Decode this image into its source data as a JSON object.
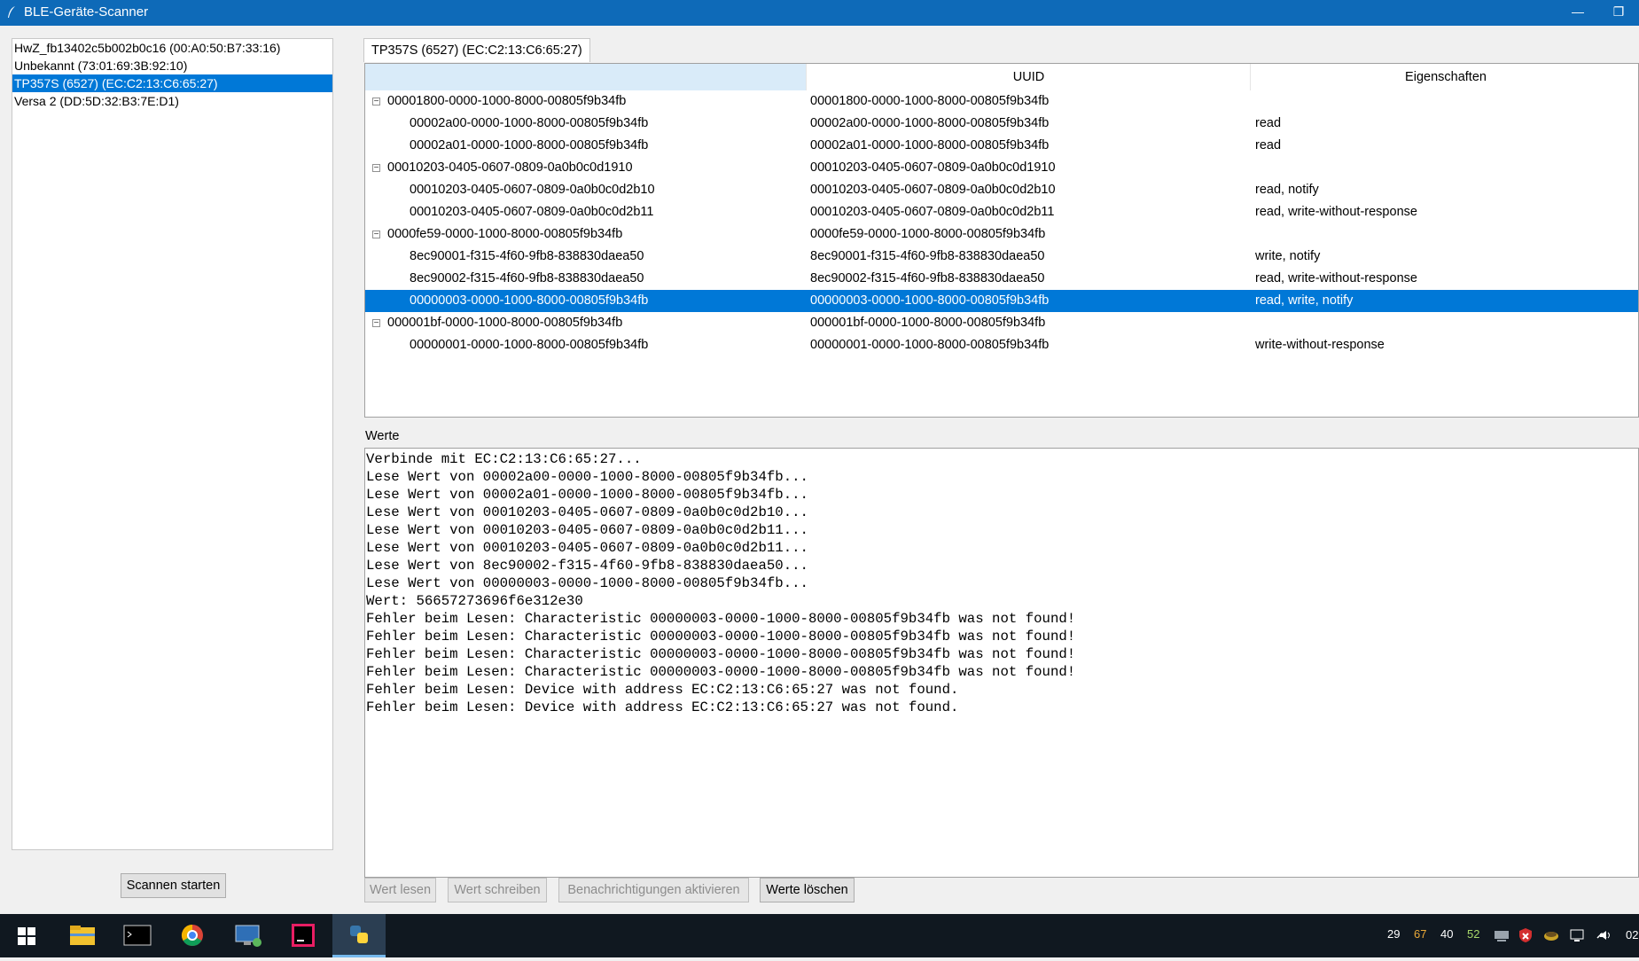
{
  "window": {
    "title": "BLE-Geräte-Scanner",
    "minimize_glyph": "—",
    "restore_glyph": "❐"
  },
  "devices": [
    {
      "label": "HwZ_fb13402c5b002b0c16 (00:A0:50:B7:33:16)",
      "selected": false
    },
    {
      "label": "Unbekannt (73:01:69:3B:92:10)",
      "selected": false
    },
    {
      "label": "TP357S (6527) (EC:C2:13:C6:65:27)",
      "selected": true
    },
    {
      "label": "Versa 2 (DD:5D:32:B3:7E:D1)",
      "selected": false
    }
  ],
  "scan_button": "Scannen starten",
  "tab": {
    "label": "TP357S (6527) (EC:C2:13:C6:65:27)"
  },
  "tree": {
    "columns": [
      "",
      "UUID",
      "Eigenschaften"
    ],
    "expander_glyph": "−",
    "rows": [
      {
        "name": "00001800-0000-1000-8000-00805f9b34fb",
        "uuid": "00001800-0000-1000-8000-00805f9b34fb",
        "props": "",
        "level": 0
      },
      {
        "name": "00002a00-0000-1000-8000-00805f9b34fb",
        "uuid": "00002a00-0000-1000-8000-00805f9b34fb",
        "props": "read",
        "level": 1
      },
      {
        "name": "00002a01-0000-1000-8000-00805f9b34fb",
        "uuid": "00002a01-0000-1000-8000-00805f9b34fb",
        "props": "read",
        "level": 1
      },
      {
        "name": "00010203-0405-0607-0809-0a0b0c0d1910",
        "uuid": "00010203-0405-0607-0809-0a0b0c0d1910",
        "props": "",
        "level": 0
      },
      {
        "name": "00010203-0405-0607-0809-0a0b0c0d2b10",
        "uuid": "00010203-0405-0607-0809-0a0b0c0d2b10",
        "props": "read, notify",
        "level": 1
      },
      {
        "name": "00010203-0405-0607-0809-0a0b0c0d2b11",
        "uuid": "00010203-0405-0607-0809-0a0b0c0d2b11",
        "props": "read, write-without-response",
        "level": 1
      },
      {
        "name": "0000fe59-0000-1000-8000-00805f9b34fb",
        "uuid": "0000fe59-0000-1000-8000-00805f9b34fb",
        "props": "",
        "level": 0
      },
      {
        "name": "8ec90001-f315-4f60-9fb8-838830daea50",
        "uuid": "8ec90001-f315-4f60-9fb8-838830daea50",
        "props": "write, notify",
        "level": 1
      },
      {
        "name": "8ec90002-f315-4f60-9fb8-838830daea50",
        "uuid": "8ec90002-f315-4f60-9fb8-838830daea50",
        "props": "read, write-without-response",
        "level": 1
      },
      {
        "name": "00000003-0000-1000-8000-00805f9b34fb",
        "uuid": "00000003-0000-1000-8000-00805f9b34fb",
        "props": "read, write, notify",
        "level": 1,
        "selected": true
      },
      {
        "name": "000001bf-0000-1000-8000-00805f9b34fb",
        "uuid": "000001bf-0000-1000-8000-00805f9b34fb",
        "props": "",
        "level": 0
      },
      {
        "name": "00000001-0000-1000-8000-00805f9b34fb",
        "uuid": "00000001-0000-1000-8000-00805f9b34fb",
        "props": "write-without-response",
        "level": 1
      }
    ]
  },
  "values": {
    "label": "Werte",
    "lines": [
      "Verbinde mit EC:C2:13:C6:65:27...",
      "Lese Wert von 00002a00-0000-1000-8000-00805f9b34fb...",
      "Lese Wert von 00002a01-0000-1000-8000-00805f9b34fb...",
      "Lese Wert von 00010203-0405-0607-0809-0a0b0c0d2b10...",
      "Lese Wert von 00010203-0405-0607-0809-0a0b0c0d2b11...",
      "Lese Wert von 00010203-0405-0607-0809-0a0b0c0d2b11...",
      "Lese Wert von 8ec90002-f315-4f60-9fb8-838830daea50...",
      "Lese Wert von 00000003-0000-1000-8000-00805f9b34fb...",
      "Wert: 56657273696f6e312e30",
      "Fehler beim Lesen: Characteristic 00000003-0000-1000-8000-00805f9b34fb was not found!",
      "Fehler beim Lesen: Characteristic 00000003-0000-1000-8000-00805f9b34fb was not found!",
      "Fehler beim Lesen: Characteristic 00000003-0000-1000-8000-00805f9b34fb was not found!",
      "Fehler beim Lesen: Characteristic 00000003-0000-1000-8000-00805f9b34fb was not found!",
      "Fehler beim Lesen: Device with address EC:C2:13:C6:65:27 was not found.",
      "Fehler beim Lesen: Device with address EC:C2:13:C6:65:27 was not found."
    ]
  },
  "actions": {
    "read": {
      "label": "Wert lesen",
      "enabled": false
    },
    "write": {
      "label": "Wert schreiben",
      "enabled": false
    },
    "notify": {
      "label": "Benachrichtigungen aktivieren",
      "enabled": false
    },
    "clear": {
      "label": "Werte löschen",
      "enabled": true
    }
  },
  "taskbar": {
    "apps": [
      "windows-start-icon",
      "file-explorer-icon",
      "terminal-icon",
      "chrome-icon",
      "remote-desktop-icon",
      "intellij-icon",
      "python-icon"
    ],
    "tray_numbers": [
      {
        "value": "29",
        "color": "#ffffff"
      },
      {
        "value": "67",
        "color": "#e8a838"
      },
      {
        "value": "40",
        "color": "#ffffff"
      },
      {
        "value": "52",
        "color": "#a8d86a"
      }
    ],
    "clock_partial": "02"
  }
}
